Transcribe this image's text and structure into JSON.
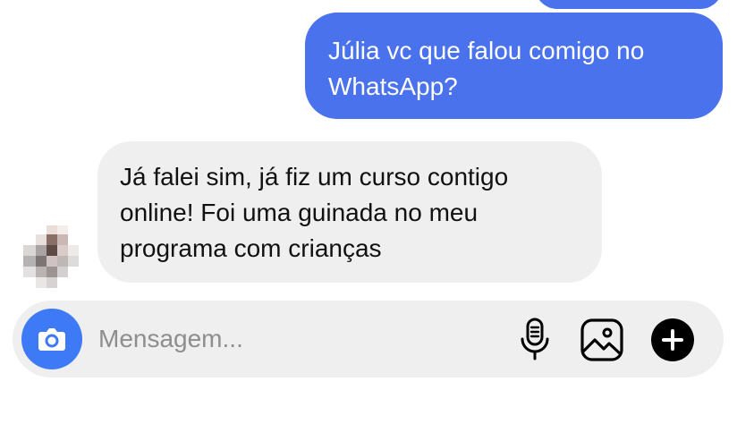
{
  "colors": {
    "outgoing_bubble": "#4a72ec",
    "incoming_bubble": "#efefef",
    "camera_button": "#3f7af6",
    "composer_bg": "#efefef"
  },
  "messages": [
    {
      "direction": "outgoing",
      "lines": [
        "Júlia vc que falou comigo no",
        "WhatsApp?"
      ]
    },
    {
      "direction": "incoming",
      "lines": [
        "Já falei sim, já fiz um curso contigo",
        "online! Foi uma guinada no meu",
        "programa com crianças"
      ]
    }
  ],
  "composer": {
    "placeholder": "Mensagem...",
    "value": "",
    "icons": {
      "camera": "camera-icon",
      "mic": "microphone-icon",
      "gallery": "image-gallery-icon",
      "plus": "plus-icon"
    }
  }
}
